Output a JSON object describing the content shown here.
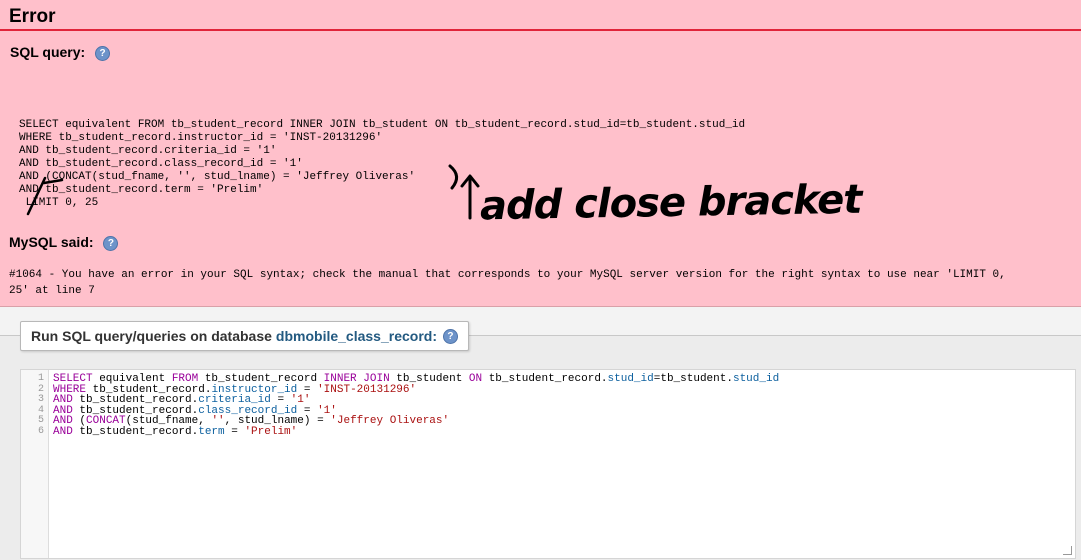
{
  "error": {
    "title": "Error",
    "sql_query_label": "SQL query:",
    "sql_lines": [
      "SELECT equivalent FROM tb_student_record INNER JOIN tb_student ON tb_student_record.stud_id=tb_student.stud_id",
      "WHERE tb_student_record.instructor_id = 'INST-20131296'",
      "AND tb_student_record.criteria_id = '1'",
      "AND tb_student_record.class_record_id = '1'",
      "AND (CONCAT(stud_fname, '', stud_lname) = 'Jeffrey Oliveras'",
      "AND tb_student_record.term = 'Prelim'",
      "LIMIT 0, 25"
    ],
    "mysql_said_label": "MySQL said:",
    "mysql_message_line1": "#1064 - You have an error in your SQL syntax; check the manual that corresponds to your MySQL server version for the right syntax to use near 'LIMIT 0,",
    "mysql_message_line2": "25' at line 7",
    "annotation": "add close bracket",
    "background_color": "#ffc0cb",
    "rule_color": "#e0243a"
  },
  "query_box": {
    "legend_prefix": "Run SQL query/queries on database",
    "database_name": "dbmobile_class_record:",
    "line_numbers": [
      "1",
      "2",
      "3",
      "4",
      "5",
      "6"
    ]
  },
  "icons": {
    "help": "help-icon"
  }
}
